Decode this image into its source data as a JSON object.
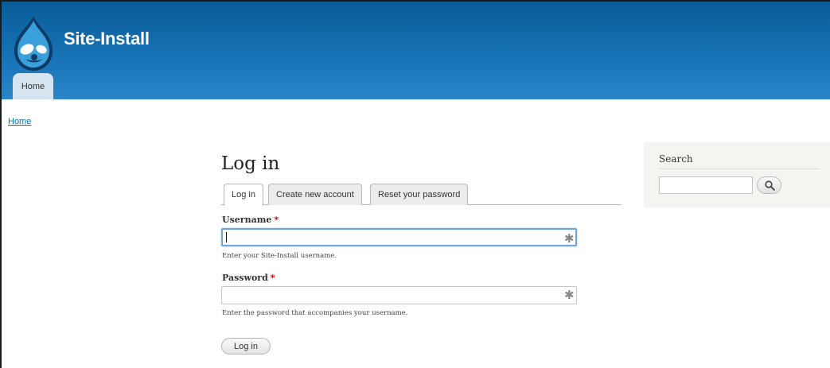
{
  "header": {
    "site_name": "Site-Install",
    "logo_icon": "drupal-drop-icon",
    "primary_tab": "Home"
  },
  "breadcrumb": {
    "home_label": "Home"
  },
  "main": {
    "title": "Log in",
    "tabs": [
      {
        "label": "Log in",
        "active": true
      },
      {
        "label": "Create new account",
        "active": false
      },
      {
        "label": "Reset your password",
        "active": false
      }
    ],
    "username": {
      "label": "Username",
      "required_mark": "*",
      "value": "",
      "description": "Enter your Site-Install username."
    },
    "password": {
      "label": "Password",
      "required_mark": "*",
      "value": "",
      "description": "Enter the password that accompanies your username."
    },
    "submit_label": "Log in"
  },
  "sidebar": {
    "search_title": "Search",
    "search_value": "",
    "search_icon": "magnifier-icon"
  },
  "colors": {
    "header_top": "#0a5c98",
    "header_bottom": "#2a86c8",
    "link": "#0071b3",
    "required": "#cc0000",
    "focus": "#6fa6e0"
  }
}
